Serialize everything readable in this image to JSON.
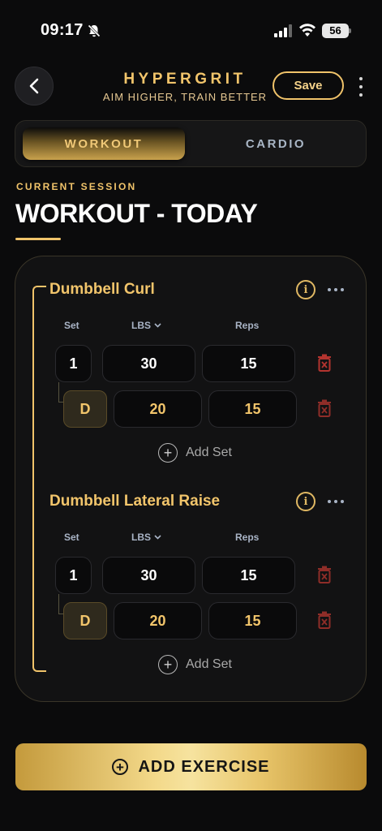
{
  "status_bar": {
    "time": "09:17",
    "battery": "56"
  },
  "header": {
    "brand": "HYPERGRIT",
    "tagline": "AIM HIGHER, TRAIN BETTER",
    "save_label": "Save"
  },
  "tabs": [
    {
      "label": "WORKOUT",
      "active": true
    },
    {
      "label": "CARDIO",
      "active": false
    }
  ],
  "session": {
    "label": "CURRENT SESSION",
    "title": "WORKOUT - TODAY"
  },
  "columns": {
    "set": "Set",
    "weight": "LBS",
    "reps": "Reps"
  },
  "exercises": [
    {
      "name": "Dumbbell Curl",
      "sets": [
        {
          "set": "1",
          "weight": "30",
          "reps": "15"
        },
        {
          "set": "D",
          "weight": "20",
          "reps": "15"
        }
      ],
      "add_set_label": "Add Set"
    },
    {
      "name": "Dumbbell Lateral Raise",
      "sets": [
        {
          "set": "1",
          "weight": "30",
          "reps": "15"
        },
        {
          "set": "D",
          "weight": "20",
          "reps": "15"
        }
      ],
      "add_set_label": "Add Set"
    }
  ],
  "add_exercise_label": "ADD EXERCISE",
  "colors": {
    "accent": "#f0c36a",
    "background": "#0b0b0c",
    "delete": "#b3342f"
  }
}
